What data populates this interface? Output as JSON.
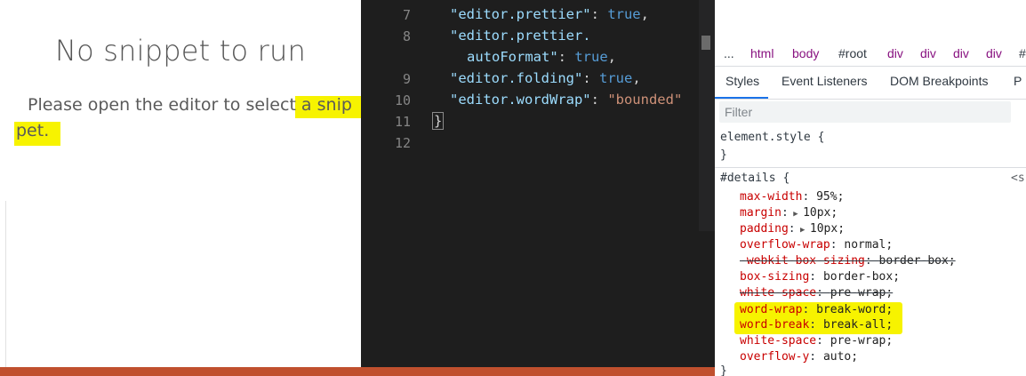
{
  "left": {
    "title": "No snippet to run",
    "message_line1": "Please open the editor to select a ",
    "message_highlight1": "snip",
    "message_line2_highlight": "pet.",
    "colors": {
      "highlight": "#f7f300",
      "statusbar": "#c0502e"
    }
  },
  "editor": {
    "line_numbers": [
      "7",
      "8",
      "",
      "9",
      "10",
      "11",
      "12"
    ],
    "lines": [
      {
        "key": "\"editor.prettier\"",
        "value": "true",
        "value_type": "bool"
      },
      {
        "key": "\"editor.prettier.",
        "value": "",
        "value_type": "none"
      },
      {
        "key": "autoFormat\"",
        "value": "true",
        "value_type": "bool"
      },
      {
        "key": "\"editor.folding\"",
        "value": "true",
        "value_type": "bool"
      },
      {
        "key": "\"editor.wordWrap\"",
        "value": "\"bounded\"",
        "value_type": "string"
      }
    ],
    "closing_brace": "}",
    "colors": {
      "background": "#1e1e1e",
      "key": "#9cdcfe",
      "bool": "#569cd6",
      "string": "#ce9178"
    }
  },
  "devtools": {
    "breadcrumbs": [
      "...",
      "html",
      "body",
      "#root",
      "div",
      "div",
      "div",
      "div",
      "#"
    ],
    "tabs": [
      "Styles",
      "Event Listeners",
      "DOM Breakpoints",
      "P"
    ],
    "active_tab": "Styles",
    "filter_placeholder": "Filter",
    "element_style_selector": "element.style {",
    "element_style_close": "}",
    "details_selector": "#details {",
    "source_link": "<s",
    "rules": [
      {
        "prop": "max-width",
        "value": "95%;",
        "struck": false,
        "expandable": false,
        "highlight": false
      },
      {
        "prop": "margin",
        "value": "10px;",
        "struck": false,
        "expandable": true,
        "highlight": false
      },
      {
        "prop": "padding",
        "value": "10px;",
        "struck": false,
        "expandable": true,
        "highlight": false
      },
      {
        "prop": "overflow-wrap",
        "value": "normal;",
        "struck": false,
        "expandable": false,
        "highlight": false
      },
      {
        "prop": "-webkit-box-sizing",
        "value": "border-box;",
        "struck": true,
        "expandable": false,
        "highlight": false
      },
      {
        "prop": "box-sizing",
        "value": "border-box;",
        "struck": false,
        "expandable": false,
        "highlight": false
      },
      {
        "prop": "white-space",
        "value": "pre-wrap;",
        "struck": true,
        "expandable": false,
        "highlight": false
      },
      {
        "prop": "word-wrap",
        "value": "break-word;",
        "struck": false,
        "expandable": false,
        "highlight": true
      },
      {
        "prop": "word-break",
        "value": "break-all;",
        "struck": false,
        "expandable": false,
        "highlight": true
      },
      {
        "prop": "white-space",
        "value": "pre-wrap;",
        "struck": false,
        "expandable": false,
        "highlight": false
      },
      {
        "prop": "overflow-y",
        "value": "auto;",
        "struck": false,
        "expandable": false,
        "highlight": false
      }
    ],
    "closing_brace": "}"
  }
}
